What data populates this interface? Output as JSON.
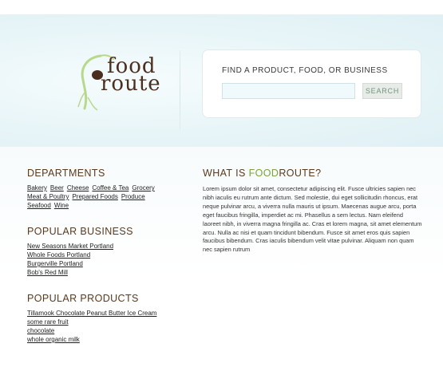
{
  "top_nav": {
    "items": [
      "",
      "",
      "",
      "",
      "",
      "",
      "",
      ""
    ]
  },
  "logo": {
    "word1": "food",
    "word2": "route"
  },
  "search": {
    "label": "FIND A PRODUCT, FOOD, OR BUSINESS",
    "placeholder": "",
    "value": "",
    "button_label": "SEARCH"
  },
  "departments": {
    "title": "DEPARTMENTS",
    "links": [
      "Bakery",
      "Beer",
      "Cheese",
      "Coffee & Tea",
      "Grocery",
      "Meat & Poultry",
      "Prepared Foods",
      "Produce",
      "Seafood",
      "Wine"
    ]
  },
  "popular_business": {
    "title": "POPULAR BUSINESS",
    "links": [
      "New Seasons Market Portland",
      "Whole Foods Portland",
      "Burgerville Portland",
      "Bob's Red Mill"
    ]
  },
  "popular_products": {
    "title": "POPULAR PRODUCTS",
    "links": [
      "Tillamook Chocolate Peanut Butter Ice Cream",
      "some rare fruit",
      "chocolate",
      "whole organic milk"
    ]
  },
  "about": {
    "title_prefix": "WHAT IS ",
    "title_highlight": "FOOD",
    "title_suffix": "ROUTE?",
    "body": "Lorem ipsum dolor sit amet, consectetur adipiscing elit. Fusce ultricies sapien nec nibh iaculis eu rutrum ante dictum. Sed molestie, dui eget sollicitudin rhoncus, erat neque pulvinar arcu, a viverra nulla mauris ut ipsum. Maecenas augue arcu, porta eget faucibus fringilla, imperdiet ac mi. Phasellus a sem lectus. Nam eleifend laoreet nibh, in viverra magna fringilla ac. Cras et lorem magna, sit amet elementum arcu. Nulla ac nisi et quam tincidunt bibendum. Fusce sit amet eros quis sapien faucibus bibendum. Cras iaculis bibendum velit vitae pulvinar. Aliquam non quam nec sapien rutrum"
  },
  "colors": {
    "brand_brown": "#4a2e1e",
    "heading_brown": "#5a3a1e",
    "brand_green": "#7aa33d",
    "hero_bg": "#e8f5f8"
  }
}
